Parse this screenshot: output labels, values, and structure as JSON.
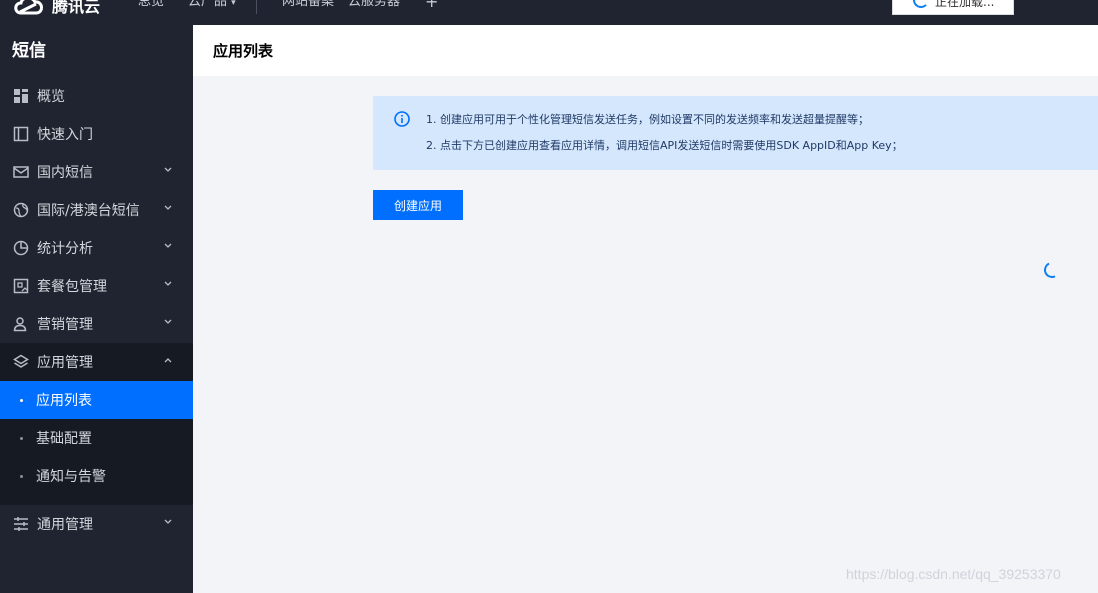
{
  "topbar": {
    "brand": "腾讯云",
    "nav": [
      "总览",
      "云产品",
      "网站备案",
      "云服务器"
    ],
    "plus": "+",
    "loading_text": "正在加载..."
  },
  "sidebar": {
    "title": "短信",
    "items": [
      {
        "label": "概览",
        "icon": "grid-icon"
      },
      {
        "label": "快速入门",
        "icon": "book-icon"
      },
      {
        "label": "国内短信",
        "icon": "mail-icon",
        "chevron": "down"
      },
      {
        "label": "国际/港澳台短信",
        "icon": "globe-icon",
        "chevron": "down"
      },
      {
        "label": "统计分析",
        "icon": "pie-chart-icon",
        "chevron": "down"
      },
      {
        "label": "套餐包管理",
        "icon": "package-icon",
        "chevron": "down"
      },
      {
        "label": "营销管理",
        "icon": "user-group-icon",
        "chevron": "down"
      },
      {
        "label": "应用管理",
        "icon": "layers-icon",
        "chevron": "up"
      }
    ],
    "sub_items": [
      {
        "label": "应用列表",
        "active": true
      },
      {
        "label": "基础配置",
        "active": false
      },
      {
        "label": "通知与告警",
        "active": false
      }
    ],
    "bottom_item": {
      "label": "通用管理",
      "icon": "sliders-icon",
      "chevron": "down"
    }
  },
  "main": {
    "title": "应用列表",
    "notice": {
      "line1": "1. 创建应用可用于个性化管理短信发送任务，例如设置不同的发送频率和发送超量提醒等；",
      "line2": "2. 点击下方已创建应用查看应用详情，调用短信API发送短信时需要使用SDK AppID和App Key；"
    },
    "create_button": "创建应用"
  },
  "watermark": "https://blog.csdn.net/qq_39253370",
  "colors": {
    "sidebar_bg": "#1f2430",
    "active_blue": "#006eff",
    "notice_bg": "#d5e7fd"
  }
}
